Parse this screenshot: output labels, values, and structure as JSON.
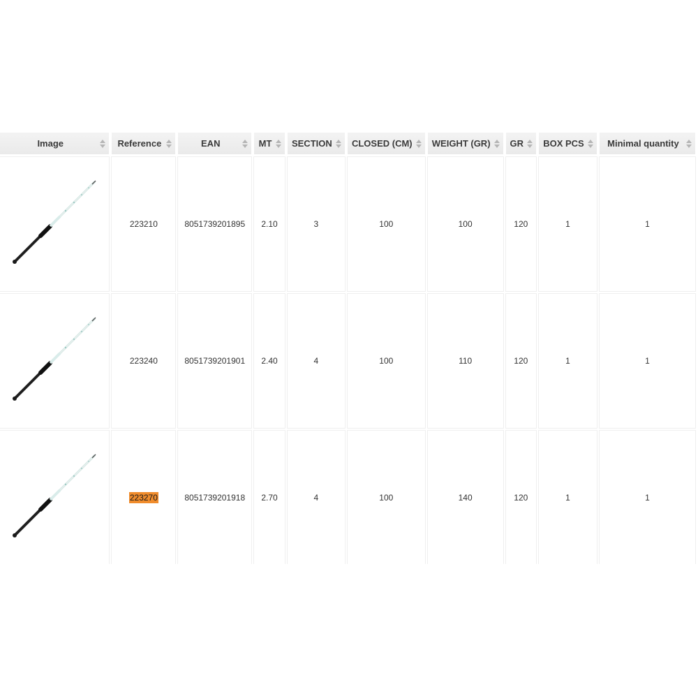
{
  "accent_color": "#f08c2c",
  "columns": [
    "Image",
    "Reference",
    "EAN",
    "MT",
    "SECTION",
    "CLOSED (CM)",
    "WEIGHT (GR)",
    "GR",
    "BOX PCS",
    "Minimal quantity"
  ],
  "sort_icon": "sort-arrows-icon",
  "rows": [
    {
      "image_icon": "fishing-rod-image",
      "reference": "223210",
      "ean": "8051739201895",
      "mt": "2.10",
      "section": "3",
      "closed": "100",
      "weight": "100",
      "gr": "120",
      "box_pcs": "1",
      "min_qty": "1"
    },
    {
      "image_icon": "fishing-rod-image",
      "reference": "223240",
      "ean": "8051739201901",
      "mt": "2.40",
      "section": "4",
      "closed": "100",
      "weight": "110",
      "gr": "120",
      "box_pcs": "1",
      "min_qty": "1"
    },
    {
      "image_icon": "fishing-rod-image",
      "reference": "223270",
      "ean": "8051739201918",
      "mt": "2.70",
      "section": "4",
      "closed": "100",
      "weight": "140",
      "gr": "120",
      "box_pcs": "1",
      "min_qty": "1"
    }
  ]
}
